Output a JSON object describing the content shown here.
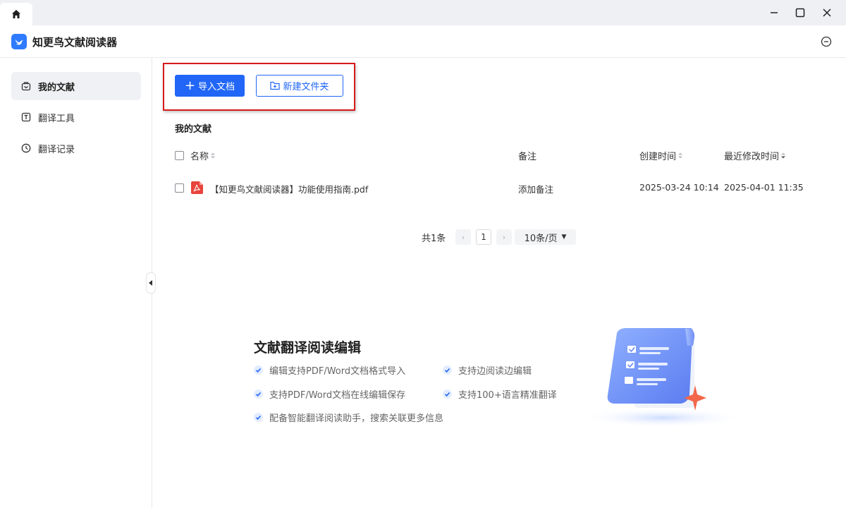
{
  "app": {
    "title": "知更鸟文献阅读器"
  },
  "window": {
    "minimize_icon": "minimize-icon",
    "maximize_icon": "maximize-icon",
    "close_icon": "close-icon"
  },
  "sidebar": {
    "items": [
      {
        "label": "我的文献",
        "icon": "document-bag-icon",
        "active": true
      },
      {
        "label": "翻译工具",
        "icon": "translate-icon",
        "active": false
      },
      {
        "label": "翻译记录",
        "icon": "clock-icon",
        "active": false
      }
    ]
  },
  "toolbar": {
    "import_label": "导入文档",
    "new_folder_label": "新建文件夹"
  },
  "section": {
    "title": "我的文献"
  },
  "table": {
    "columns": {
      "name": "名称",
      "note": "备注",
      "created": "创建时间",
      "modified": "最近修改时间"
    },
    "rows": [
      {
        "name": "【知更鸟文献阅读器】功能使用指南.pdf",
        "note": "添加备注",
        "created": "2025-03-24 10:14",
        "modified": "2025-04-01 11:35"
      }
    ]
  },
  "pagination": {
    "total": "共1条",
    "page": "1",
    "page_size": "10条/页"
  },
  "promo": {
    "title": "文献翻译阅读编辑",
    "features": [
      "编辑支持PDF/Word文档格式导入",
      "支持边阅读边编辑",
      "支持PDF/Word文档在线编辑保存",
      "支持100+语言精准翻译",
      "配备智能翻译阅读助手，搜索关联更多信息"
    ]
  },
  "colors": {
    "primary": "#2166f6",
    "highlight": "#d71a1a",
    "sidebar_active": "#f0f1f4"
  }
}
